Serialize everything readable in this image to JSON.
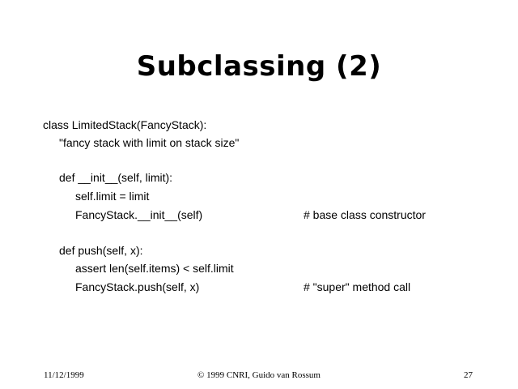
{
  "slide": {
    "title": "Subclassing (2)",
    "code_lines": [
      "class LimitedStack(FancyStack):",
      "\"fancy stack with limit on stack size\"",
      "def __init__(self, limit):",
      "self.limit = limit",
      "FancyStack.__init__(self)",
      "def push(self, x):",
      "assert len(self.items) < self.limit",
      "FancyStack.push(self, x)"
    ],
    "comments": [
      "# base class constructor",
      "# \"super\" method call"
    ]
  },
  "footer": {
    "date": "11/12/1999",
    "copyright": "© 1999 CNRI, Guido van Rossum",
    "page_number": "27"
  }
}
